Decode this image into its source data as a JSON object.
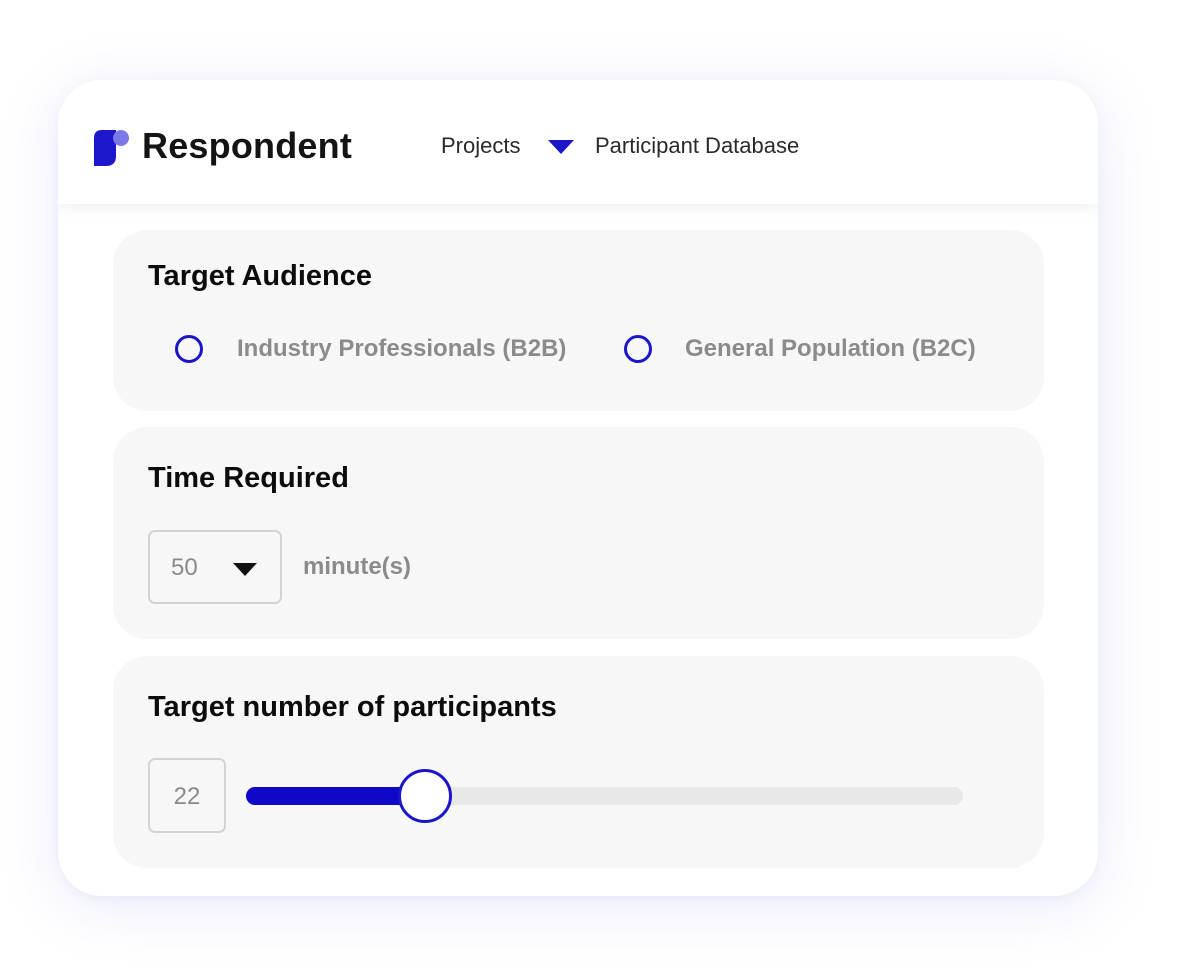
{
  "header": {
    "brand": "Respondent",
    "logo_icon": "respondent-logo-icon",
    "nav": {
      "projects_label": "Projects",
      "projects_dropdown_icon": "caret-down-icon",
      "participant_database_label": "Participant Database"
    }
  },
  "target_audience": {
    "title": "Target Audience",
    "options": [
      {
        "label": "Industry Professionals (B2B)",
        "selected": false
      },
      {
        "label": "General Population (B2C)",
        "selected": false
      }
    ]
  },
  "time_required": {
    "title": "Time Required",
    "selected_value": "50",
    "unit": "minute(s)"
  },
  "target_participants": {
    "title": "Target number of participants",
    "value": "22",
    "slider_fill_fraction": 0.25
  },
  "colors": {
    "accent": "#1a16c8",
    "slider_fill": "#0f08c6",
    "logo_primary": "#1d17cc",
    "logo_secondary": "#7a78ea",
    "panel_background": "#f7f7f7",
    "muted_text": "#8b8b8b"
  }
}
